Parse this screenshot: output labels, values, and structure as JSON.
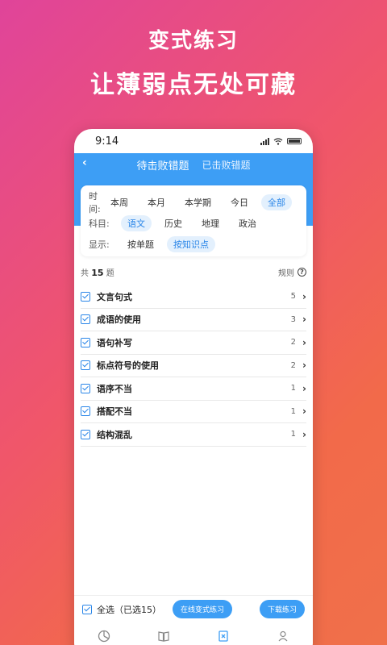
{
  "promo": {
    "title1": "变式练习",
    "title2": "让薄弱点无处可藏"
  },
  "status": {
    "time": "9:14"
  },
  "header": {
    "tabs": [
      {
        "label": "待击败错题",
        "active": true
      },
      {
        "label": "已击败错题",
        "active": false
      }
    ]
  },
  "filters": {
    "time": {
      "label": "时间:",
      "options": [
        "本周",
        "本月",
        "本学期",
        "今日",
        "全部"
      ],
      "selected": "全部"
    },
    "subject": {
      "label": "科目:",
      "options": [
        "语文",
        "历史",
        "地理",
        "政治"
      ],
      "selected": "语文"
    },
    "display": {
      "label": "显示:",
      "options": [
        "按单题",
        "按知识点"
      ],
      "selected": "按知识点"
    }
  },
  "summary": {
    "prefix": "共",
    "count": "15",
    "suffix": "题",
    "rule_label": "规则"
  },
  "items": [
    {
      "name": "文言句式",
      "count": "5"
    },
    {
      "name": "成语的使用",
      "count": "3"
    },
    {
      "name": "语句补写",
      "count": "2"
    },
    {
      "name": "标点符号的使用",
      "count": "2"
    },
    {
      "name": "语序不当",
      "count": "1"
    },
    {
      "name": "搭配不当",
      "count": "1"
    },
    {
      "name": "结构混乱",
      "count": "1"
    }
  ],
  "bottom": {
    "select_all": "全选（已选15）",
    "online_button": "在线变式练习",
    "download_button": "下载练习"
  },
  "colors": {
    "accent": "#3d9ef5",
    "chip_bg": "#e3f0fd"
  },
  "tabbar_icons": [
    "stats-icon",
    "book-icon",
    "wrong-questions-icon",
    "profile-icon"
  ]
}
